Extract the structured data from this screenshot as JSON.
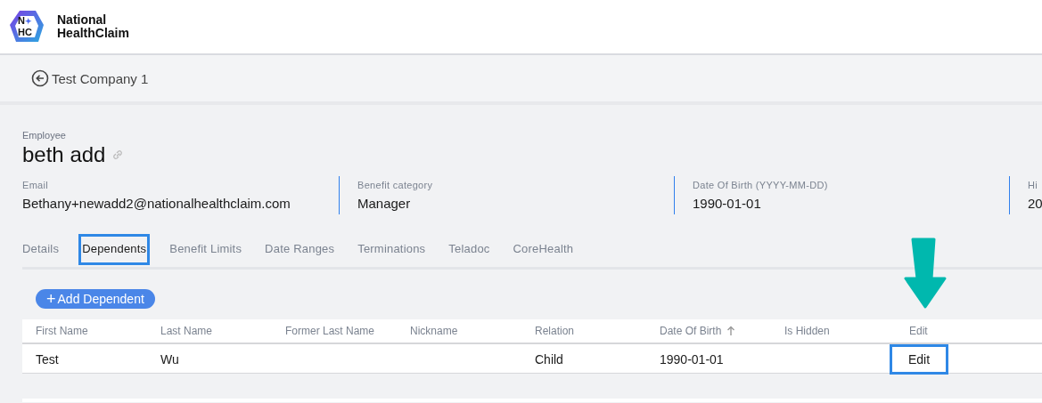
{
  "brand": {
    "name_line1": "National",
    "name_line2": "HealthClaim",
    "logo_top": "N",
    "logo_star": "✦",
    "logo_bottom": "HC"
  },
  "breadcrumb": {
    "label": "Test Company 1"
  },
  "employee": {
    "caption": "Employee",
    "name": "beth add"
  },
  "fields": [
    {
      "label": "Email",
      "value": "Bethany+newadd2@nationalhealthclaim.com"
    },
    {
      "label": "Benefit category",
      "value": "Manager"
    },
    {
      "label": "Date Of Birth (YYYY-MM-DD)",
      "value": "1990-01-01"
    },
    {
      "label": "Hi",
      "value": "20"
    }
  ],
  "tabs": [
    {
      "label": "Details",
      "selected": false,
      "highlighted": false
    },
    {
      "label": "Dependents",
      "selected": true,
      "highlighted": true
    },
    {
      "label": "Benefit Limits",
      "selected": false,
      "highlighted": false
    },
    {
      "label": "Date Ranges",
      "selected": false,
      "highlighted": false
    },
    {
      "label": "Terminations",
      "selected": false,
      "highlighted": false
    },
    {
      "label": "Teladoc",
      "selected": false,
      "highlighted": false
    },
    {
      "label": "CoreHealth",
      "selected": false,
      "highlighted": false
    }
  ],
  "add_button": {
    "icon": "+",
    "label": "Add Dependent"
  },
  "table": {
    "columns": [
      {
        "label": "First Name",
        "sorted": false
      },
      {
        "label": "Last Name",
        "sorted": false
      },
      {
        "label": "Former Last Name",
        "sorted": false
      },
      {
        "label": "Nickname",
        "sorted": false
      },
      {
        "label": "Relation",
        "sorted": false
      },
      {
        "label": "Date Of Birth",
        "sorted": true
      },
      {
        "label": "Is Hidden",
        "sorted": false
      },
      {
        "label": "Edit",
        "sorted": false
      }
    ],
    "rows": [
      {
        "first_name": "Test",
        "last_name": "Wu",
        "relation": "Child",
        "date_of_birth": "1990-01-01",
        "edit": "Edit",
        "edit_highlighted": true,
        "arrow": true
      }
    ]
  }
}
